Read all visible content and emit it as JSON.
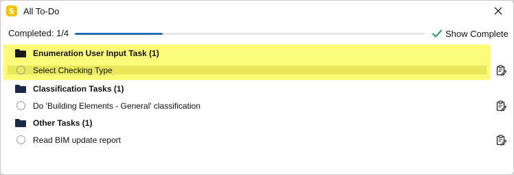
{
  "window": {
    "title": "All To-Do",
    "app_icon_letter": "S"
  },
  "progress": {
    "label": "Completed: 1/4",
    "completed": 1,
    "total": 4,
    "fraction": 0.25
  },
  "toolbar": {
    "show_complete_label": "Show Complete"
  },
  "groups": [
    {
      "label": "Enumeration User Input Task (1)",
      "tasks": [
        {
          "label": "Select Checking Type"
        }
      ]
    },
    {
      "label": "Classification Tasks (1)",
      "tasks": [
        {
          "label": "Do 'Building Elements - General' classification"
        }
      ]
    },
    {
      "label": "Other Tasks (1)",
      "tasks": [
        {
          "label": "Read BIM update report"
        }
      ]
    }
  ],
  "colors": {
    "accent": "#1f6fb8",
    "highlight": "#fbfb78",
    "highlight_selected": "#e8e85a",
    "check": "#2aa26b",
    "app_icon": "#f5c400"
  }
}
